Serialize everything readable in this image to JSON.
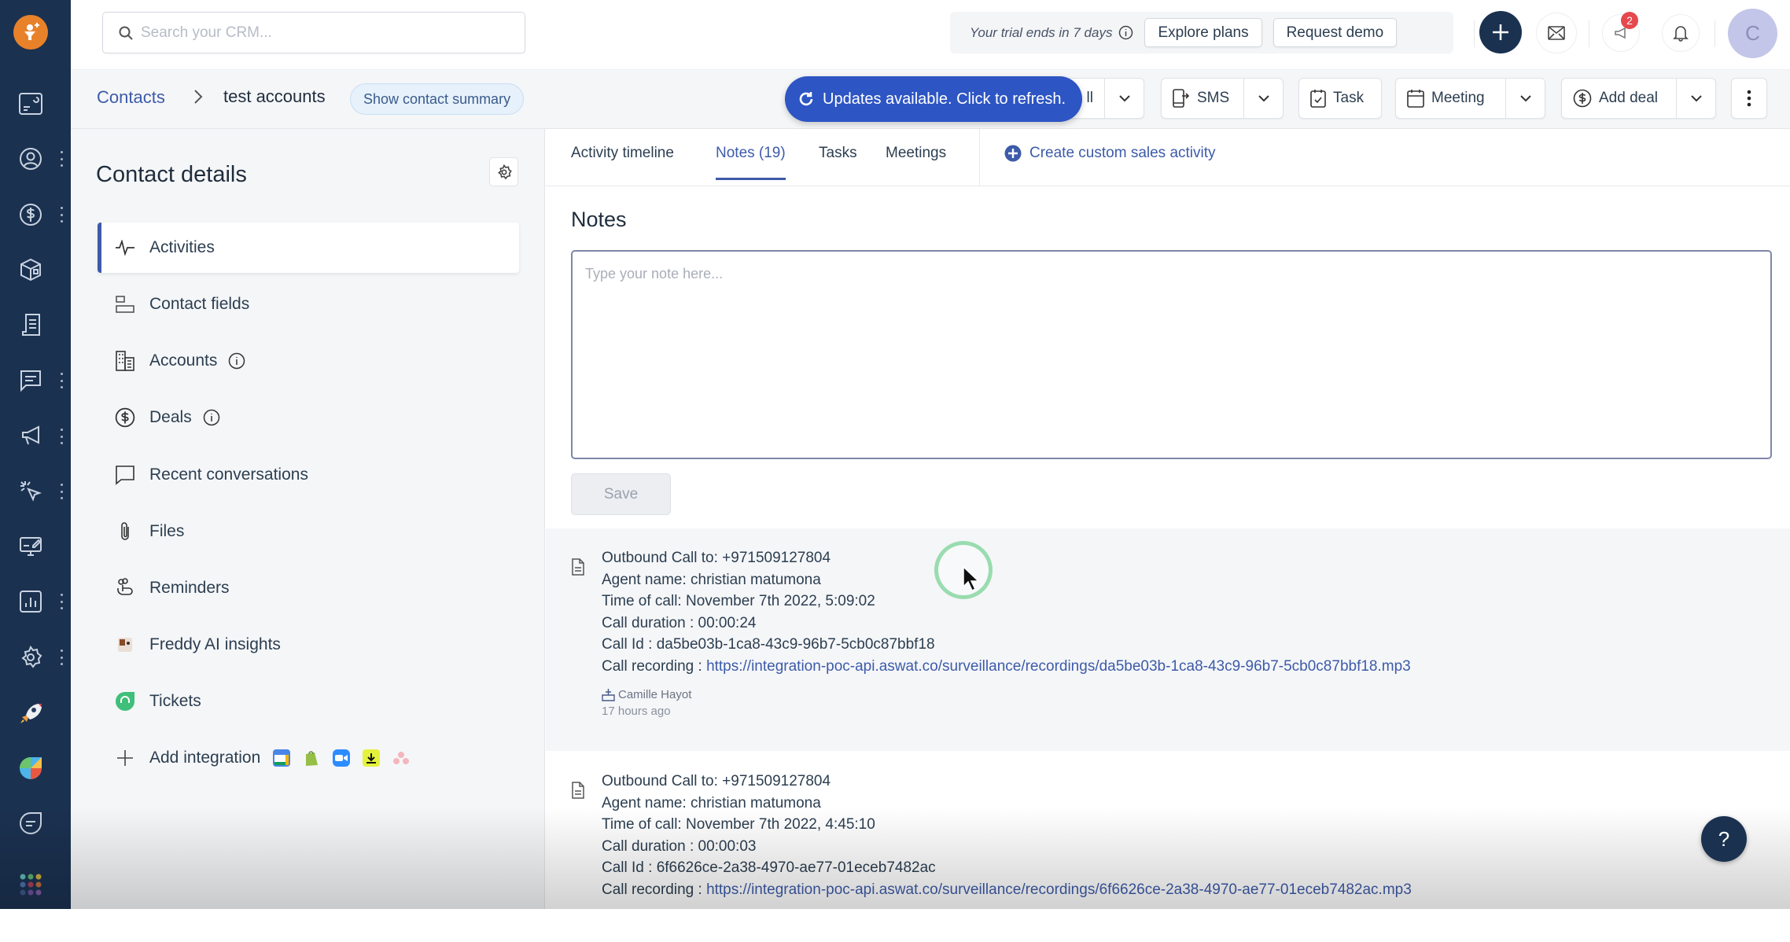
{
  "rail": {
    "items": [
      {
        "icon": "dashboard-icon",
        "has_menu": false
      },
      {
        "icon": "contacts-icon",
        "has_menu": true
      },
      {
        "icon": "deals-icon",
        "has_menu": true
      },
      {
        "icon": "products-icon",
        "has_menu": false
      },
      {
        "icon": "documents-icon",
        "has_menu": false
      },
      {
        "icon": "conversations-icon",
        "has_menu": true
      },
      {
        "icon": "campaigns-icon",
        "has_menu": true
      },
      {
        "icon": "automation-icon",
        "has_menu": true
      },
      {
        "icon": "marketplace-icon",
        "has_menu": false
      },
      {
        "icon": "reports-icon",
        "has_menu": true
      },
      {
        "icon": "settings-icon",
        "has_menu": true
      },
      {
        "icon": "rocket-icon",
        "has_menu": false
      },
      {
        "icon": "freshworks-icon",
        "has_menu": false
      },
      {
        "icon": "chat-icon",
        "has_menu": false
      },
      {
        "icon": "apps-grid-icon",
        "has_menu": false
      }
    ],
    "brand_color": "#E8822A"
  },
  "topbar": {
    "search_placeholder": "Search your CRM...",
    "trial_text": "Your trial ends in 7 days",
    "explore_plans": "Explore plans",
    "request_demo": "Request demo",
    "alerts_count": "2",
    "avatar_initial": "C"
  },
  "breadcrumb": {
    "root": "Contacts",
    "current": "test accounts",
    "summary_button": "Show contact summary"
  },
  "toast": {
    "text": "Updates available. Click to refresh."
  },
  "actions": {
    "call_partial": "ll",
    "sms": "SMS",
    "task": "Task",
    "meeting": "Meeting",
    "add_deal": "Add deal"
  },
  "contact_details": {
    "title": "Contact details",
    "menu": [
      {
        "label": "Activities",
        "icon": "activity-icon",
        "active": true,
        "info": false
      },
      {
        "label": "Contact fields",
        "icon": "fields-icon",
        "active": false,
        "info": false
      },
      {
        "label": "Accounts",
        "icon": "building-icon",
        "active": false,
        "info": true
      },
      {
        "label": "Deals",
        "icon": "dollar-icon",
        "active": false,
        "info": true
      },
      {
        "label": "Recent conversations",
        "icon": "chat-bubble-icon",
        "active": false,
        "info": false
      },
      {
        "label": "Files",
        "icon": "paperclip-icon",
        "active": false,
        "info": false
      },
      {
        "label": "Reminders",
        "icon": "reminder-icon",
        "active": false,
        "info": false
      },
      {
        "label": "Freddy AI insights",
        "icon": "freddy-icon",
        "active": false,
        "info": false
      },
      {
        "label": "Tickets",
        "icon": "freshdesk-icon",
        "active": false,
        "info": false
      },
      {
        "label": "Add integration",
        "icon": "plus-icon",
        "active": false,
        "info": false
      }
    ],
    "integrations": [
      "google-calendar-icon",
      "shopify-icon",
      "zoom-icon",
      "download-app-icon",
      "asana-icon"
    ]
  },
  "tabs": {
    "items": [
      {
        "label": "Activity timeline",
        "active": false
      },
      {
        "label": "Notes (19)",
        "active": true
      },
      {
        "label": "Tasks",
        "active": false
      },
      {
        "label": "Meetings",
        "active": false
      }
    ],
    "create_custom": "Create custom sales activity"
  },
  "notes": {
    "title": "Notes",
    "placeholder": "Type your note here...",
    "save_label": "Save",
    "items": [
      {
        "lines": [
          "Outbound Call to: +971509127804",
          "Agent name: christian matumona",
          "Time of call: November 7th 2022, 5:09:02",
          "Call duration : 00:00:24",
          "Call Id : da5be03b-1ca8-43c9-96b7-5cb0c87bbf18"
        ],
        "recording_label": "Call recording : ",
        "recording_url": "https://integration-poc-api.aswat.co/surveillance/recordings/da5be03b-1ca8-43c9-96b7-5cb0c87bbf18.mp3",
        "author": "Camille Hayot",
        "ago": "17 hours ago"
      },
      {
        "lines": [
          "Outbound Call to: +971509127804",
          "Agent name: christian matumona",
          "Time of call: November 7th 2022, 4:45:10",
          "Call duration : 00:00:03",
          "Call Id : 6f6626ce-2a38-4970-ae77-01eceb7482ac"
        ],
        "recording_label": "Call recording : ",
        "recording_url": "https://integration-poc-api.aswat.co/surveillance/recordings/6f6626ce-2a38-4970-ae77-01eceb7482ac.mp3"
      }
    ]
  },
  "help": {
    "label": "?"
  }
}
